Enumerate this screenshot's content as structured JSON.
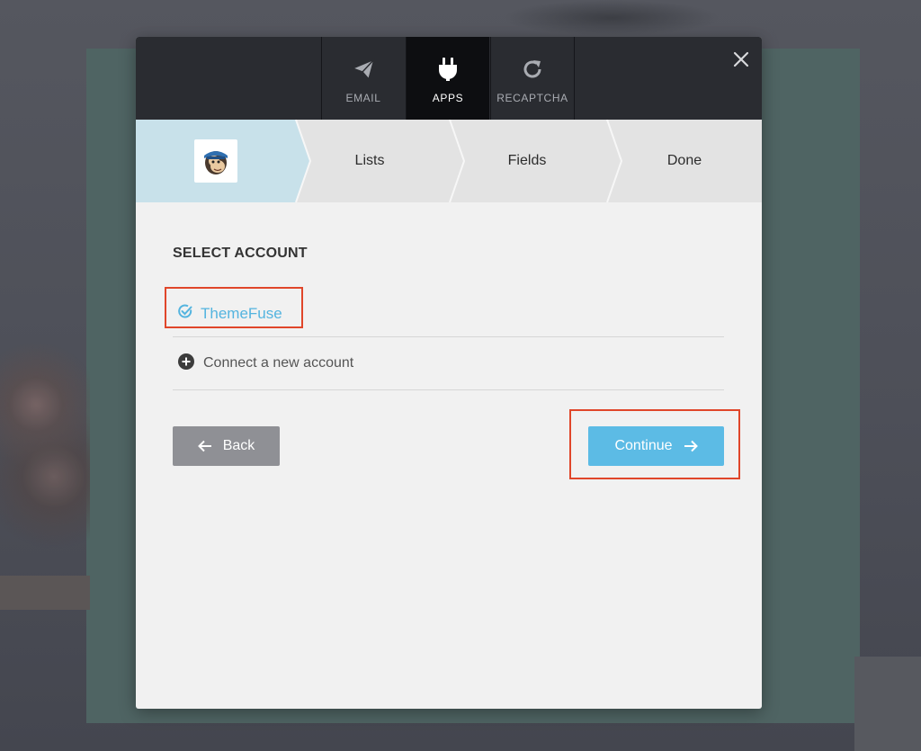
{
  "tabs": [
    {
      "label": "EMAIL",
      "icon": "paper-plane-icon",
      "active": false
    },
    {
      "label": "APPS",
      "icon": "plug-icon",
      "active": true
    },
    {
      "label": "RECAPTCHA",
      "icon": "refresh-icon",
      "active": false
    }
  ],
  "steps": {
    "app_logo": "mailchimp-logo",
    "lists": "Lists",
    "fields": "Fields",
    "done": "Done"
  },
  "content": {
    "section_title": "SELECT ACCOUNT",
    "selected_account": "ThemeFuse",
    "connect_new": "Connect a new account"
  },
  "buttons": {
    "back": "Back",
    "continue": "Continue"
  },
  "colors": {
    "accent": "#5cbbe5",
    "selected_text": "#54b4df",
    "highlight": "#e0462a",
    "topbar": "#2a2c31",
    "active_step": "#c8e1ea"
  }
}
